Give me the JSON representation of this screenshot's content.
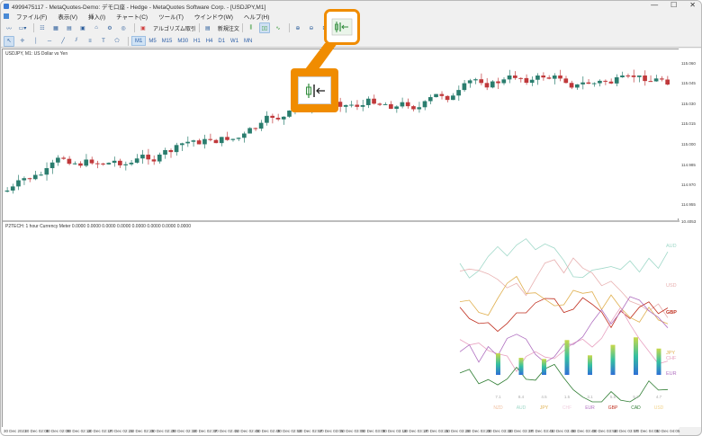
{
  "window": {
    "title": "4999475117 - MetaQuotes-Demo: デモ口座 - Hedge - MetaQuotes Software Corp. - [USDJPY,M1]",
    "controls": [
      "—",
      "☐",
      "✕"
    ]
  },
  "menu": [
    "ファイル(F)",
    "表示(V)",
    "挿入(I)",
    "チャート(C)",
    "ツール(T)",
    "ウインドウ(W)",
    "ヘルプ(H)"
  ],
  "toolbar": {
    "algo_trading_label": "アルゴリズム取引",
    "new_order_label": "新規注文",
    "timeframes": [
      "M1",
      "M5",
      "M15",
      "M30",
      "H1",
      "H4",
      "D1",
      "W1",
      "MN"
    ],
    "active_timeframe": "M1"
  },
  "chart": {
    "symbol_label": "USDJPY, M1: US Dollar vs Yen",
    "indicator_label": "P2TECH: 1 hour Currency Meter 0.0000 0.0000 0.0000 0.0000 0.0000 0.0000 0.0000 0.0000",
    "price_labels": [
      "115.060",
      "115.045",
      "115.030",
      "115.015",
      "115.000",
      "114.985",
      "114.970",
      "114.955"
    ],
    "indicator_top_value": "10.4053",
    "time_labels": [
      "30 Dec 2021",
      "30 Dec 02:05",
      "30 Dec 02:09",
      "30 Dec 02:13",
      "30 Dec 02:17",
      "30 Dec 02:21",
      "30 Dec 02:25",
      "30 Dec 02:29",
      "30 Dec 02:33",
      "30 Dec 02:37",
      "30 Dec 02:41",
      "30 Dec 02:45",
      "30 Dec 02:49",
      "30 Dec 02:53",
      "30 Dec 02:57",
      "30 Dec 03:01",
      "30 Dec 03:05",
      "30 Dec 03:09",
      "30 Dec 03:13",
      "30 Dec 03:17",
      "30 Dec 03:21",
      "30 Dec 03:25",
      "30 Dec 03:29",
      "30 Dec 03:33",
      "30 Dec 03:37",
      "30 Dec 03:41",
      "30 Dec 03:45",
      "30 Dec 03:49",
      "30 Dec 03:53",
      "30 Dec 03:57",
      "30 Dec 04:01",
      "30 Dec 04:05"
    ],
    "currency_labels_right": [
      {
        "name": "AUD",
        "color": "#9fd8c8"
      },
      {
        "name": "USD",
        "color": "#e8b0b0"
      },
      {
        "name": "GBP",
        "color": "#c03020"
      },
      {
        "name": "JPY",
        "color": "#e0b050"
      },
      {
        "name": "CHF",
        "color": "#e8a0c0"
      },
      {
        "name": "EUR",
        "color": "#b070c0"
      }
    ],
    "meter_values": [
      "7.1",
      "8.4",
      "4.5",
      "1.5",
      "3.1",
      "5.5",
      "5.2",
      "4.7"
    ],
    "meter_currencies": [
      {
        "name": "NZD",
        "color": "#f0c0a0"
      },
      {
        "name": "AUD",
        "color": "#9fd8c8"
      },
      {
        "name": "JPY",
        "color": "#e0b050"
      },
      {
        "name": "CHF",
        "color": "#f0d0e0"
      },
      {
        "name": "EUR",
        "color": "#b070c0"
      },
      {
        "name": "GBP",
        "color": "#c03020"
      },
      {
        "name": "CAD",
        "color": "#2e7d32"
      },
      {
        "name": "USD",
        "color": "#f2d28a"
      }
    ],
    "highlight_icon": "chart-shift-icon"
  }
}
